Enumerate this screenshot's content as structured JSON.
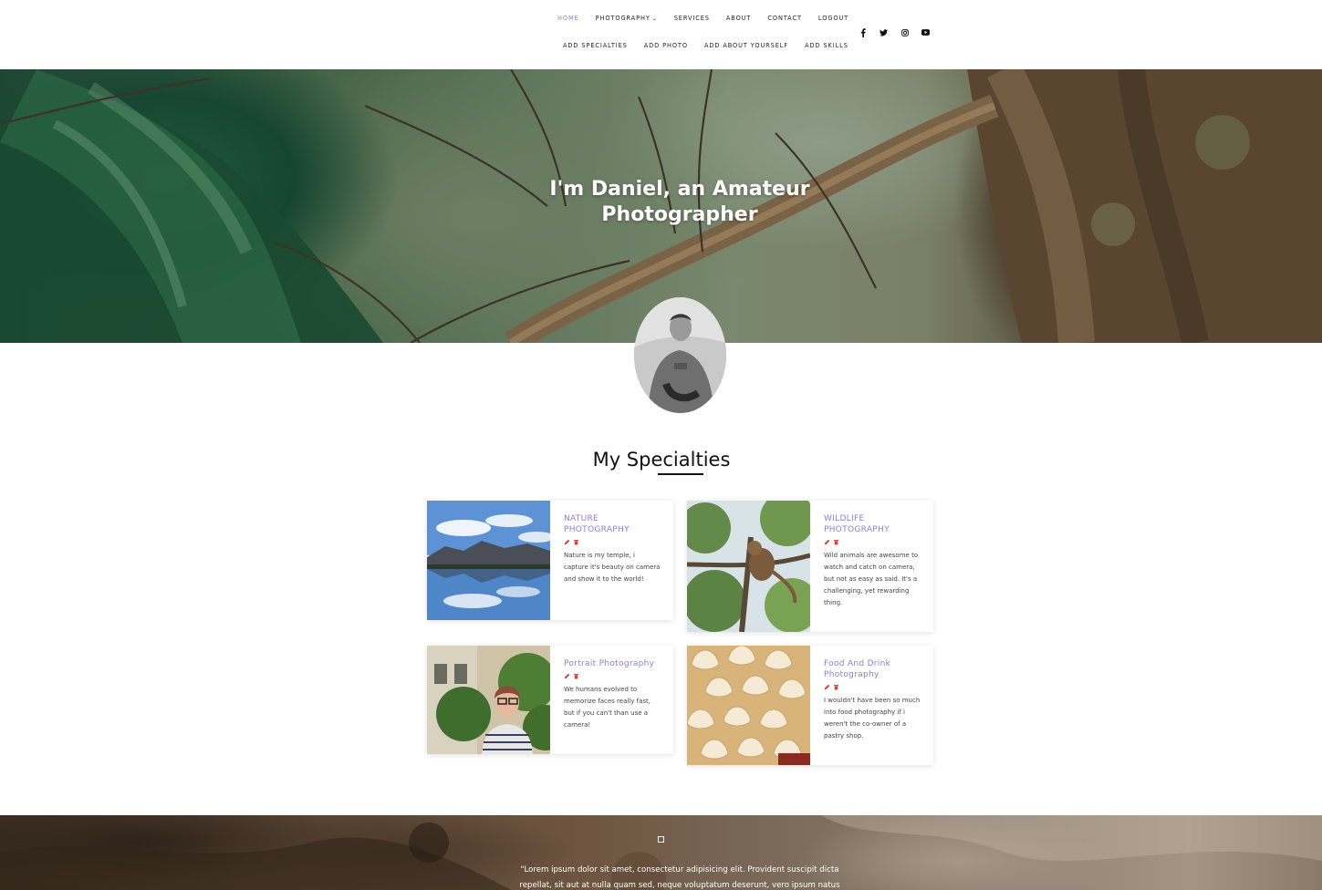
{
  "nav": {
    "row1": [
      {
        "label": "HOME",
        "active": true
      },
      {
        "label": "PHOTOGRAPHY",
        "dropdown": true
      },
      {
        "label": "SERVICES"
      },
      {
        "label": "ABOUT"
      },
      {
        "label": "CONTACT"
      },
      {
        "label": "LOGOUT"
      }
    ],
    "row2": [
      {
        "label": "ADD SPECIALTIES"
      },
      {
        "label": "ADD PHOTO"
      },
      {
        "label": "ADD ABOUT YOURSELF"
      },
      {
        "label": "ADD SKILLS"
      }
    ],
    "caret": "⌄",
    "social": [
      "facebook-icon",
      "twitter-icon",
      "instagram-icon",
      "youtube-icon"
    ]
  },
  "hero": {
    "title": "I'm Daniel, an Amateur Photographer"
  },
  "specialties": {
    "heading": "My Specialties",
    "cards": [
      {
        "title": "NATURE PHOTOGRAPHY",
        "text": "Nature is my temple, i capture it's beauty on camera and show it to the world!"
      },
      {
        "title": "WILDLIFE PHOTOGRAPHY",
        "text": "Wild animals are awesome to watch and catch on camera, but not as easy as said. It's a challenging, yet rewarding thing."
      },
      {
        "title": "Portrait Photography",
        "text": "We humans evolved to memorize faces really fast, but if you can't than use a camera!"
      },
      {
        "title": "Food And Drink Photography",
        "text": "I wouldn't have been so much into food photography if i weren't the co-owner of a pastry shop."
      }
    ]
  },
  "testimonial": {
    "quote": "\"Lorem ipsum dolor sit amet, consectetur adipisicing elit. Provident suscipit dicta repellat, sit aut at nulla quam sed, neque voluptatum deserunt, vero ipsum natus"
  },
  "colors": {
    "accent": "#8a7ee0",
    "edit_icon": "#e03b3b",
    "delete_icon": "#e03b3b"
  }
}
